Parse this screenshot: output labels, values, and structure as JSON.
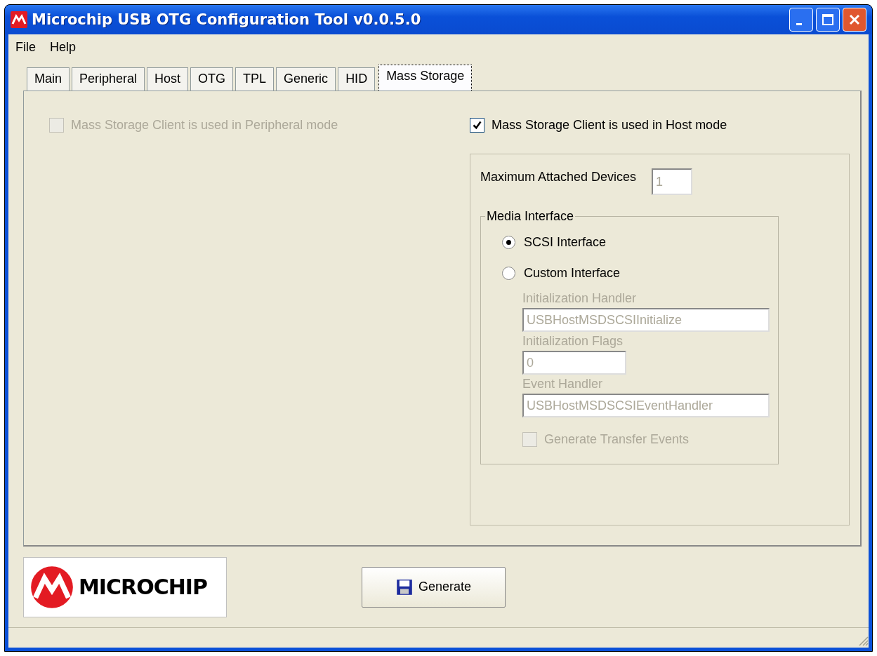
{
  "window": {
    "title": "Microchip USB OTG Configuration Tool v0.0.5.0"
  },
  "menu": [
    {
      "label": "File"
    },
    {
      "label": "Help"
    }
  ],
  "tabs": [
    {
      "label": "Main",
      "selected": false
    },
    {
      "label": "Peripheral",
      "selected": false
    },
    {
      "label": "Host",
      "selected": false
    },
    {
      "label": "OTG",
      "selected": false
    },
    {
      "label": "TPL",
      "selected": false
    },
    {
      "label": "Generic",
      "selected": false
    },
    {
      "label": "HID",
      "selected": false
    },
    {
      "label": "Mass Storage",
      "selected": true
    }
  ],
  "peripheral_mode": {
    "label": "Mass Storage Client is used in Peripheral mode",
    "checked": false,
    "disabled": true
  },
  "host_mode": {
    "label": "Mass Storage Client is used in Host mode",
    "checked": true,
    "disabled": false
  },
  "max_devices": {
    "label": "Maximum Attached Devices",
    "value": "1",
    "disabled": true
  },
  "media_interface": {
    "title": "Media Interface",
    "options": [
      {
        "label": "SCSI Interface",
        "selected": true
      },
      {
        "label": "Custom Interface",
        "selected": false
      }
    ],
    "fields": [
      {
        "label": "Initialization Handler",
        "value": "USBHostMSDSCSIInitialize",
        "kind": "wide",
        "disabled": true
      },
      {
        "label": "Initialization Flags",
        "value": "0",
        "kind": "short",
        "disabled": true
      },
      {
        "label": "Event Handler",
        "value": "USBHostMSDSCSIEventHandler",
        "kind": "wide",
        "disabled": true
      }
    ],
    "transfer_events": {
      "label": "Generate Transfer Events",
      "checked": false,
      "disabled": true
    }
  },
  "logo": {
    "text": "MICROCHIP"
  },
  "generate_button": {
    "label": "Generate"
  }
}
